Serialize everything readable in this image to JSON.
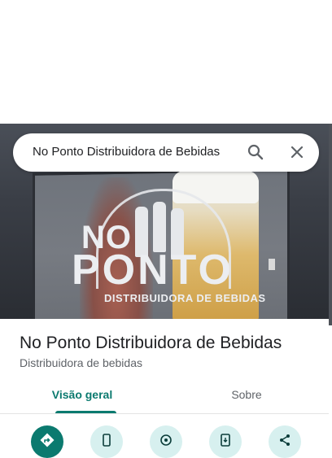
{
  "search": {
    "query": "No Ponto Distribuidora de Bebidas"
  },
  "hero": {
    "logo_line1": "NO",
    "logo_line2": "PONTO",
    "logo_subtitle": "DISTRIBUIDORA DE BEBIDAS"
  },
  "place": {
    "title": "No Ponto Distribuidora de Bebidas",
    "category": "Distribuidora de bebidas"
  },
  "tabs": [
    {
      "label": "Visão geral",
      "active": true
    },
    {
      "label": "Sobre",
      "active": false
    }
  ],
  "actions": [
    {
      "icon": "directions-icon"
    },
    {
      "icon": "phone-icon"
    },
    {
      "icon": "nearby-icon"
    },
    {
      "icon": "send-to-phone-icon"
    },
    {
      "icon": "share-icon"
    }
  ],
  "colors": {
    "accent": "#0b7a6f",
    "action_bg": "#d7f0ef",
    "title_text": "#202124",
    "secondary_text": "#5f6368"
  }
}
